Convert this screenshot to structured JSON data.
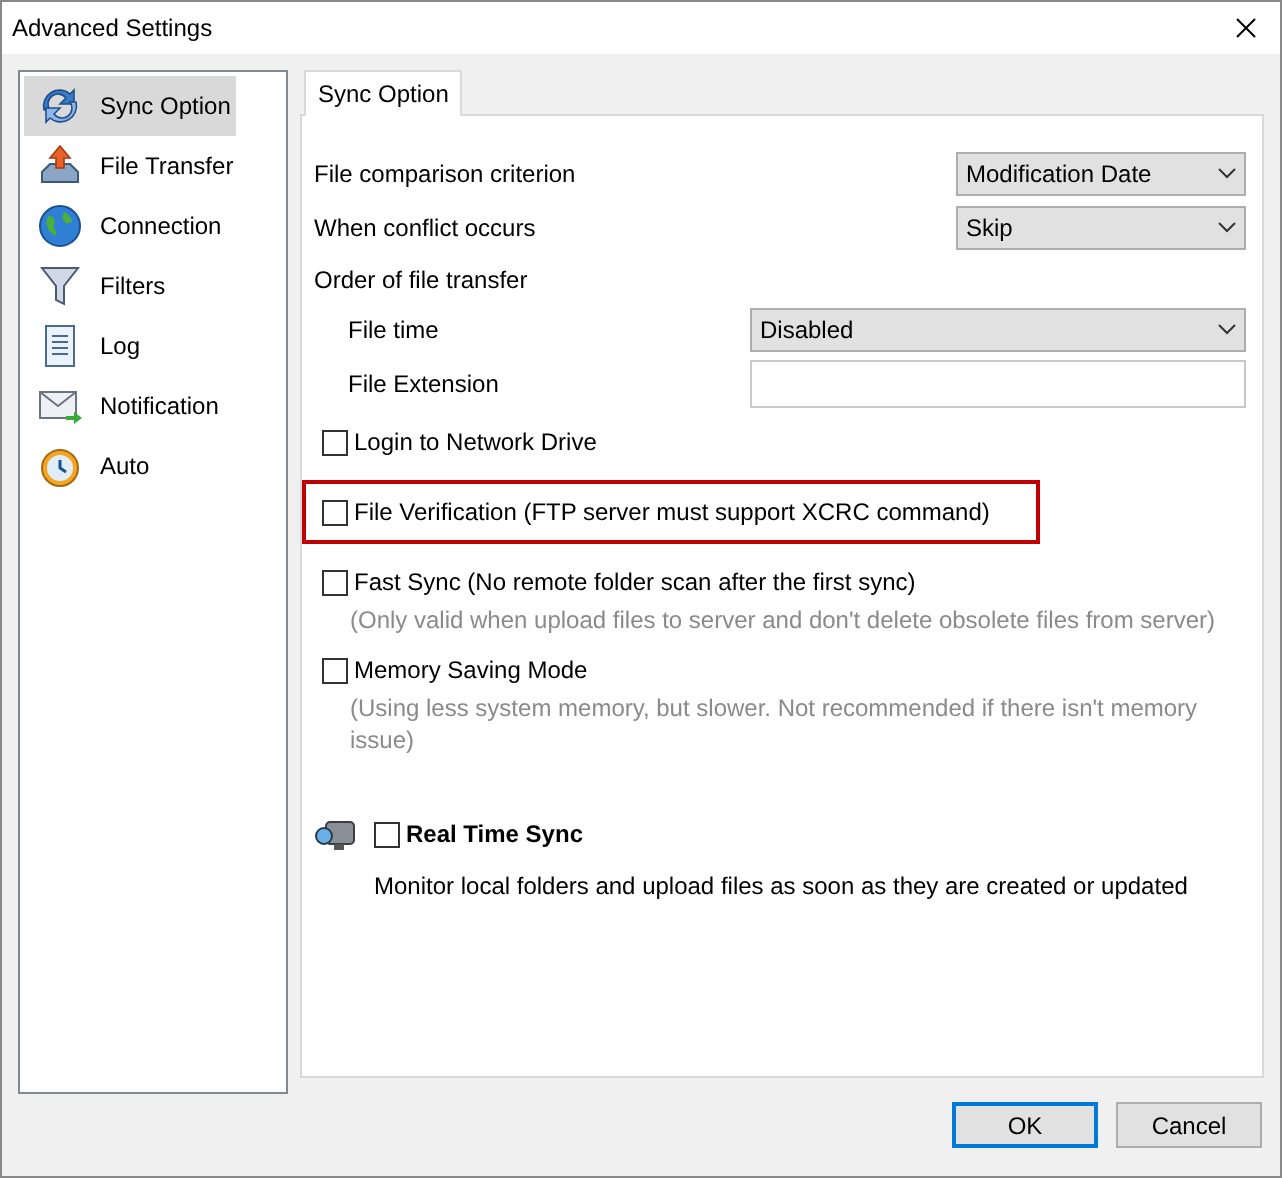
{
  "window": {
    "title": "Advanced Settings"
  },
  "sidebar": {
    "items": [
      {
        "label": "Sync Option",
        "selected": true,
        "kind": "sync"
      },
      {
        "label": "File Transfer",
        "selected": false,
        "kind": "transfer"
      },
      {
        "label": "Connection",
        "selected": false,
        "kind": "globe"
      },
      {
        "label": "Filters",
        "selected": false,
        "kind": "funnel"
      },
      {
        "label": "Log",
        "selected": false,
        "kind": "log"
      },
      {
        "label": "Notification",
        "selected": false,
        "kind": "mail"
      },
      {
        "label": "Auto",
        "selected": false,
        "kind": "clock"
      }
    ]
  },
  "tabs": [
    {
      "label": "Sync Option",
      "selected": true
    }
  ],
  "settings": [
    {
      "kind": "select",
      "label": "File comparison criterion",
      "value": "Modification Date"
    },
    {
      "kind": "select",
      "label": "When conflict occurs",
      "value": "Skip"
    },
    {
      "kind": "group",
      "label": "Order of file transfer",
      "children": [
        {
          "kind": "select",
          "label": "File time",
          "value": "Disabled"
        },
        {
          "kind": "text",
          "label": "File Extension"
        }
      ]
    }
  ],
  "options": [
    {
      "label": "Login to Network Drive",
      "checked": false,
      "highlighted": false
    },
    {
      "label": "File Verification (FTP server must support XCRC command)",
      "checked": false,
      "highlighted": true
    },
    {
      "label": "Fast Sync (No remote folder scan after the first sync)",
      "checked": false,
      "highlighted": false,
      "note": "(Only valid when upload files to server and don't delete obsolete files from server)"
    },
    {
      "label": "Memory Saving Mode",
      "checked": false,
      "highlighted": false,
      "note": "(Using less system memory, but slower. Not recommended if there isn't memory issue)"
    }
  ],
  "real_time_sync": {
    "label": "Real Time Sync",
    "checked": false,
    "description": "Monitor local folders and upload files as soon as they are created or updated"
  },
  "buttons": [
    {
      "label": "OK",
      "default": true
    },
    {
      "label": "Cancel",
      "default": false
    }
  ]
}
